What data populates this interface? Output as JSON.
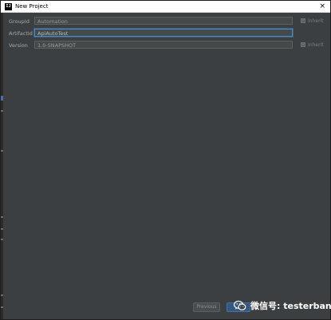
{
  "window": {
    "title": "New Project",
    "app_icon_text": "IJ",
    "close_glyph": "×"
  },
  "form": {
    "rows": [
      {
        "label": "GroupId",
        "value": "Automation",
        "active": false,
        "inherit": true,
        "inherit_label": "Inherit"
      },
      {
        "label": "ArtifactId",
        "value": "ApiAutoTest",
        "active": true,
        "inherit": false
      },
      {
        "label": "Version",
        "value": "1.0-SNAPSHOT",
        "active": false,
        "inherit": true,
        "inherit_label": "Inherit"
      }
    ]
  },
  "footer": {
    "previous_label": "Previous"
  },
  "watermark": {
    "text": "微信号: testerbang",
    "icon": "wechat-icon"
  },
  "colors": {
    "background": "#3c3f41",
    "title_bar": "#ffffff",
    "input_bg": "#45494a",
    "focus_border": "#4a88c7",
    "primary_button": "#365880"
  }
}
